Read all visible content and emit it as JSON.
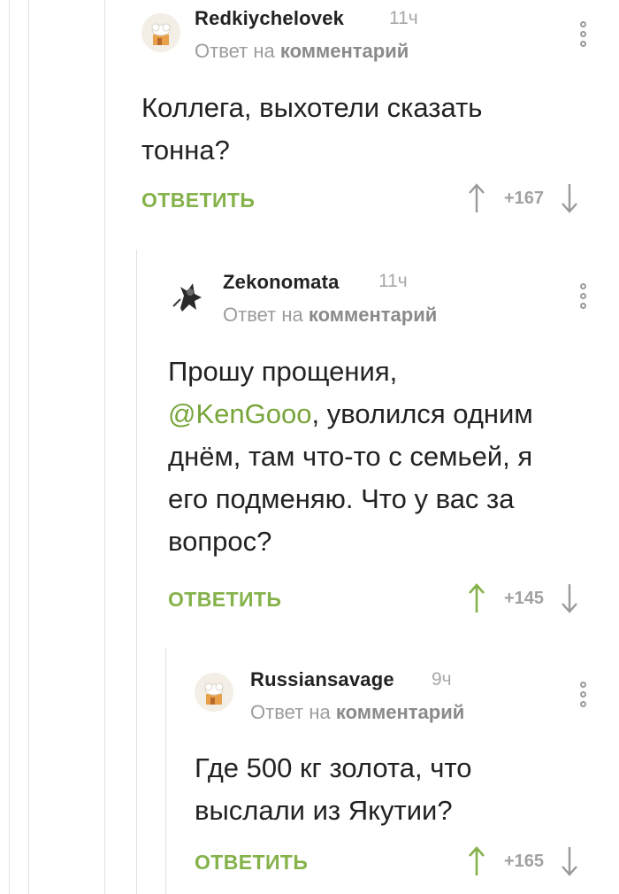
{
  "comments": [
    {
      "author": "Redkiychelovek",
      "time": "11ч",
      "reply_prefix": "Ответ на",
      "reply_target": "комментарий",
      "text_lines": [
        "Коллега, выхотели сказать",
        "тонна?"
      ],
      "reply_label": "ОТВЕТИТЬ",
      "score": "+167",
      "avatar_icon": "chef-hat-house-avatar",
      "upvote_color": "#9a9a9a"
    },
    {
      "author": "Zekonomata",
      "time": "11ч",
      "reply_prefix": "Ответ на",
      "reply_target": "комментарий",
      "text_line1": "Прошу прощения,",
      "mention": "@KenGooo",
      "text_line2_rest": ", уволился одним",
      "text_lines_rest": [
        "днём, там что-то с семьей, я",
        "его подменяю. Что у вас за",
        "вопрос?"
      ],
      "reply_label": "ОТВЕТИТЬ",
      "score": "+145",
      "avatar_icon": "dark-figure-avatar",
      "upvote_color": "#85b24a"
    },
    {
      "author": "Russiansavage",
      "time": "9ч",
      "reply_prefix": "Ответ на",
      "reply_target": "комментарий",
      "text_lines": [
        "Где 500 кг золота, что",
        "выслали из Якутии?"
      ],
      "reply_label": "ОТВЕТИТЬ",
      "score": "+165",
      "avatar_icon": "chef-hat-house-avatar",
      "upvote_color": "#85b24a"
    }
  ],
  "colors": {
    "accent_green": "#85b24a",
    "mention_green": "#77a53a",
    "muted_gray": "#9c9c9c",
    "thread_line": "#e0e0e0"
  }
}
